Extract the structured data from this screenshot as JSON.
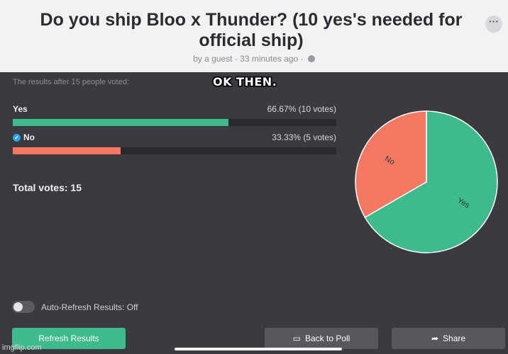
{
  "poll": {
    "title": "Do you ship Bloo x Thunder? (10 yes's needed for official ship)",
    "meta": "by a guest · 33 minutes ago ·",
    "results_caption": "The results after 15 people voted:",
    "total_votes": "Total votes: 15",
    "options": [
      {
        "label": "Yes",
        "stat": "66.67% (10 votes)",
        "percent": 66.67,
        "color": "#3ebb8c",
        "checked": false
      },
      {
        "label": "No",
        "stat": "33.33% (5 votes)",
        "percent": 33.33,
        "color": "#f47762",
        "checked": true
      }
    ]
  },
  "meme_caption": "OK THEN.",
  "auto_refresh": {
    "label": "Auto-Refresh Results: Off",
    "on": false
  },
  "buttons": {
    "refresh": "Refresh Results",
    "back": "Back to Poll",
    "share": "Share"
  },
  "icons": {
    "more": "more-options-icon",
    "globe": "globe-icon",
    "back": "poll-icon",
    "share": "share-arrow-icon",
    "check": "check-circle-icon"
  },
  "watermark": "imgflip.com",
  "chart_data": {
    "type": "pie",
    "categories": [
      "No",
      "Yes"
    ],
    "values": [
      33.33,
      66.67
    ],
    "colors": [
      "#f47762",
      "#3ebb8c"
    ]
  }
}
